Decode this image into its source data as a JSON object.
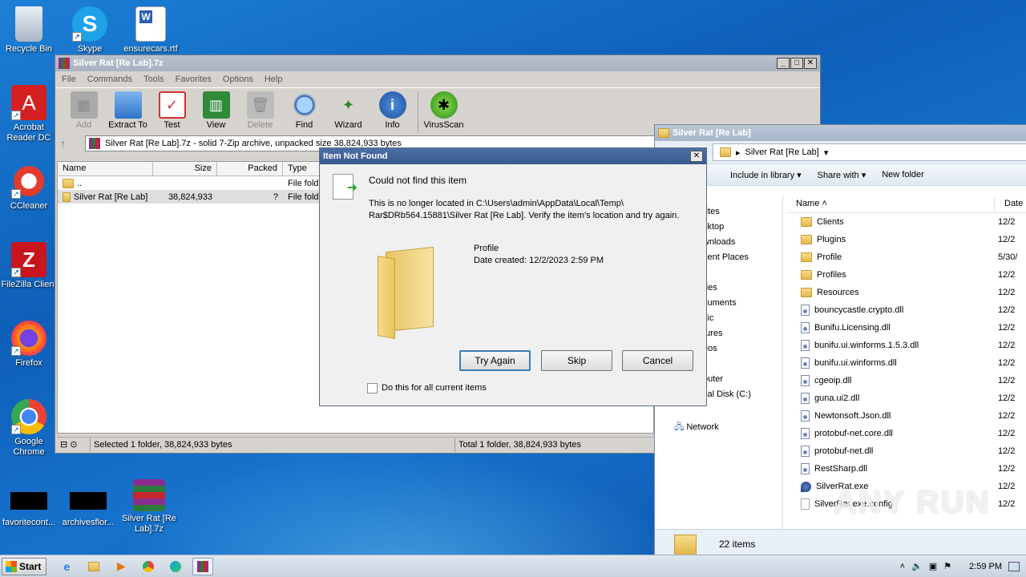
{
  "desktop": {
    "icons": [
      {
        "label": "Recycle Bin",
        "icon": "recycle-bin-icon"
      },
      {
        "label": "Skype",
        "icon": "skype-icon"
      },
      {
        "label": "ensurecars.rtf",
        "icon": "word-document-icon"
      },
      {
        "label": "Acrobat Reader DC",
        "icon": "acrobat-icon"
      },
      {
        "label": "CCleaner",
        "icon": "ccleaner-icon"
      },
      {
        "label": "FileZilla Client",
        "icon": "filezilla-icon"
      },
      {
        "label": "Firefox",
        "icon": "firefox-icon"
      },
      {
        "label": "Google Chrome",
        "icon": "chrome-icon"
      },
      {
        "label": "favoritecont...",
        "icon": "black-file-icon"
      },
      {
        "label": "archivesflor...",
        "icon": "black-file-icon"
      },
      {
        "label": "Silver Rat [Re Lab].7z",
        "icon": "winrar-archive-icon"
      }
    ]
  },
  "sevenzip": {
    "title": "Silver Rat [Re Lab].7z",
    "menu": [
      "File",
      "Commands",
      "Tools",
      "Favorites",
      "Options",
      "Help"
    ],
    "toolbar": [
      {
        "label": "Add",
        "disabled": true
      },
      {
        "label": "Extract To",
        "disabled": false
      },
      {
        "label": "Test",
        "disabled": false
      },
      {
        "label": "View",
        "disabled": false
      },
      {
        "label": "Delete",
        "disabled": true
      },
      {
        "label": "Find",
        "disabled": false
      },
      {
        "label": "Wizard",
        "disabled": false
      },
      {
        "label": "Info",
        "disabled": false
      },
      {
        "label": "VirusScan",
        "disabled": false
      }
    ],
    "address": "Silver Rat [Re Lab].7z - solid 7-Zip archive, unpacked size 38,824,933 bytes",
    "columns": [
      "Name",
      "Size",
      "Packed",
      "Type"
    ],
    "rows": [
      {
        "name": "..",
        "size": "",
        "packed": "",
        "type": "File folde"
      },
      {
        "name": "Silver Rat [Re Lab]",
        "size": "38,824,933",
        "packed": "?",
        "type": "File folde"
      }
    ],
    "status_left": "Selected 1 folder, 38,824,933 bytes",
    "status_right": "Total 1 folder, 38,824,933 bytes"
  },
  "explorer": {
    "title": "Silver Rat [Re Lab]",
    "breadcrumb": "Silver Rat [Re Lab]",
    "commands": [
      "Include in library",
      "Share with",
      "New folder"
    ],
    "nav": [
      "rites",
      "sktop",
      "wnloads",
      "cent Places",
      "ries",
      "cuments",
      "sic",
      "tures",
      "eos",
      "outer",
      "cal Disk (C:)",
      "Network"
    ],
    "col_name": "Name",
    "col_date": "Date",
    "files": [
      {
        "name": "Clients",
        "kind": "folder",
        "date": "12/2"
      },
      {
        "name": "Plugins",
        "kind": "folder",
        "date": "12/2"
      },
      {
        "name": "Profile",
        "kind": "folder",
        "date": "5/30/"
      },
      {
        "name": "Profiles",
        "kind": "folder",
        "date": "12/2"
      },
      {
        "name": "Resources",
        "kind": "folder",
        "date": "12/2"
      },
      {
        "name": "bouncycastle.crypto.dll",
        "kind": "dll",
        "date": "12/2"
      },
      {
        "name": "Bunifu.Licensing.dll",
        "kind": "dll",
        "date": "12/2"
      },
      {
        "name": "bunifu.ui.winforms.1.5.3.dll",
        "kind": "dll",
        "date": "12/2"
      },
      {
        "name": "bunifu.ui.winforms.dll",
        "kind": "dll",
        "date": "12/2"
      },
      {
        "name": "cgeoip.dll",
        "kind": "dll",
        "date": "12/2"
      },
      {
        "name": "guna.ui2.dll",
        "kind": "dll",
        "date": "12/2"
      },
      {
        "name": "Newtonsoft.Json.dll",
        "kind": "dll",
        "date": "12/2"
      },
      {
        "name": "protobuf-net.core.dll",
        "kind": "dll",
        "date": "12/2"
      },
      {
        "name": "protobuf-net.dll",
        "kind": "dll",
        "date": "12/2"
      },
      {
        "name": "RestSharp.dll",
        "kind": "dll",
        "date": "12/2"
      },
      {
        "name": "SilverRat.exe",
        "kind": "exe",
        "date": "12/2"
      },
      {
        "name": "SilverRat.exe.config",
        "kind": "config",
        "date": "12/2"
      }
    ],
    "item_count": "22 items"
  },
  "dialog": {
    "title": "Item Not Found",
    "heading": "Could not find this item",
    "message_line1": "This is no longer located in C:\\Users\\admin\\AppData\\Local\\Temp\\",
    "message_line2": "Rar$DRb564.15881\\Silver Rat [Re Lab]. Verify the item's location and try again.",
    "item_name": "Profile",
    "item_date": "Date created: 12/2/2023 2:59 PM",
    "btn_try_again": "Try Again",
    "btn_skip": "Skip",
    "btn_cancel": "Cancel",
    "checkbox_label": "Do this for all current items",
    "checkbox_checked": false
  },
  "taskbar": {
    "start_label": "Start",
    "clock": "2:59 PM"
  },
  "watermark": "ANY RUN"
}
